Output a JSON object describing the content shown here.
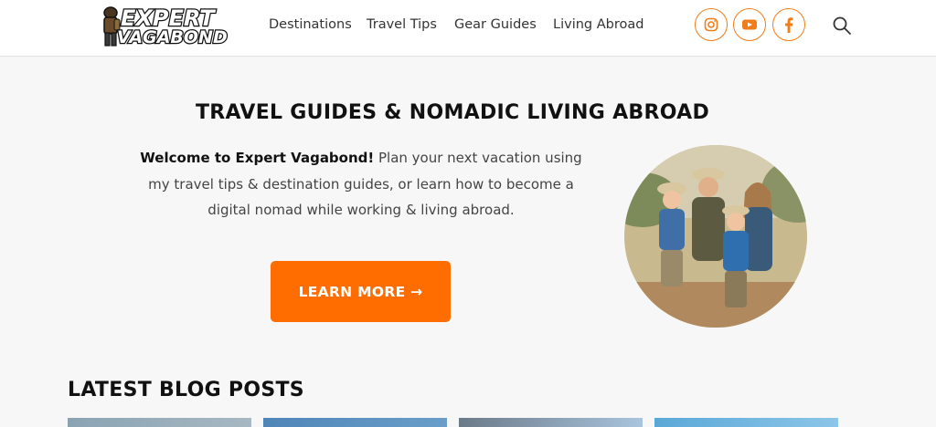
{
  "brand": {
    "logo_line1": "EXPERT",
    "logo_line2": "VAGABOND"
  },
  "nav": {
    "items": [
      "Destinations",
      "Travel Tips",
      "Gear Guides",
      "Living Abroad"
    ]
  },
  "social": {
    "icons": [
      "instagram-icon",
      "youtube-icon",
      "facebook-icon"
    ],
    "accent": "#f07d1a"
  },
  "hero": {
    "title": "TRAVEL GUIDES & NOMADIC LIVING ABROAD",
    "intro_bold": "Welcome to Expert Vagabond!",
    "intro_rest": " Plan your next vacation using my travel tips & destination guides, or learn how to become a digital nomad while working & living abroad.",
    "cta_label": "LEARN MORE →",
    "cta_color": "#ff6d00"
  },
  "blog": {
    "section_title": "LATEST BLOG POSTS"
  }
}
